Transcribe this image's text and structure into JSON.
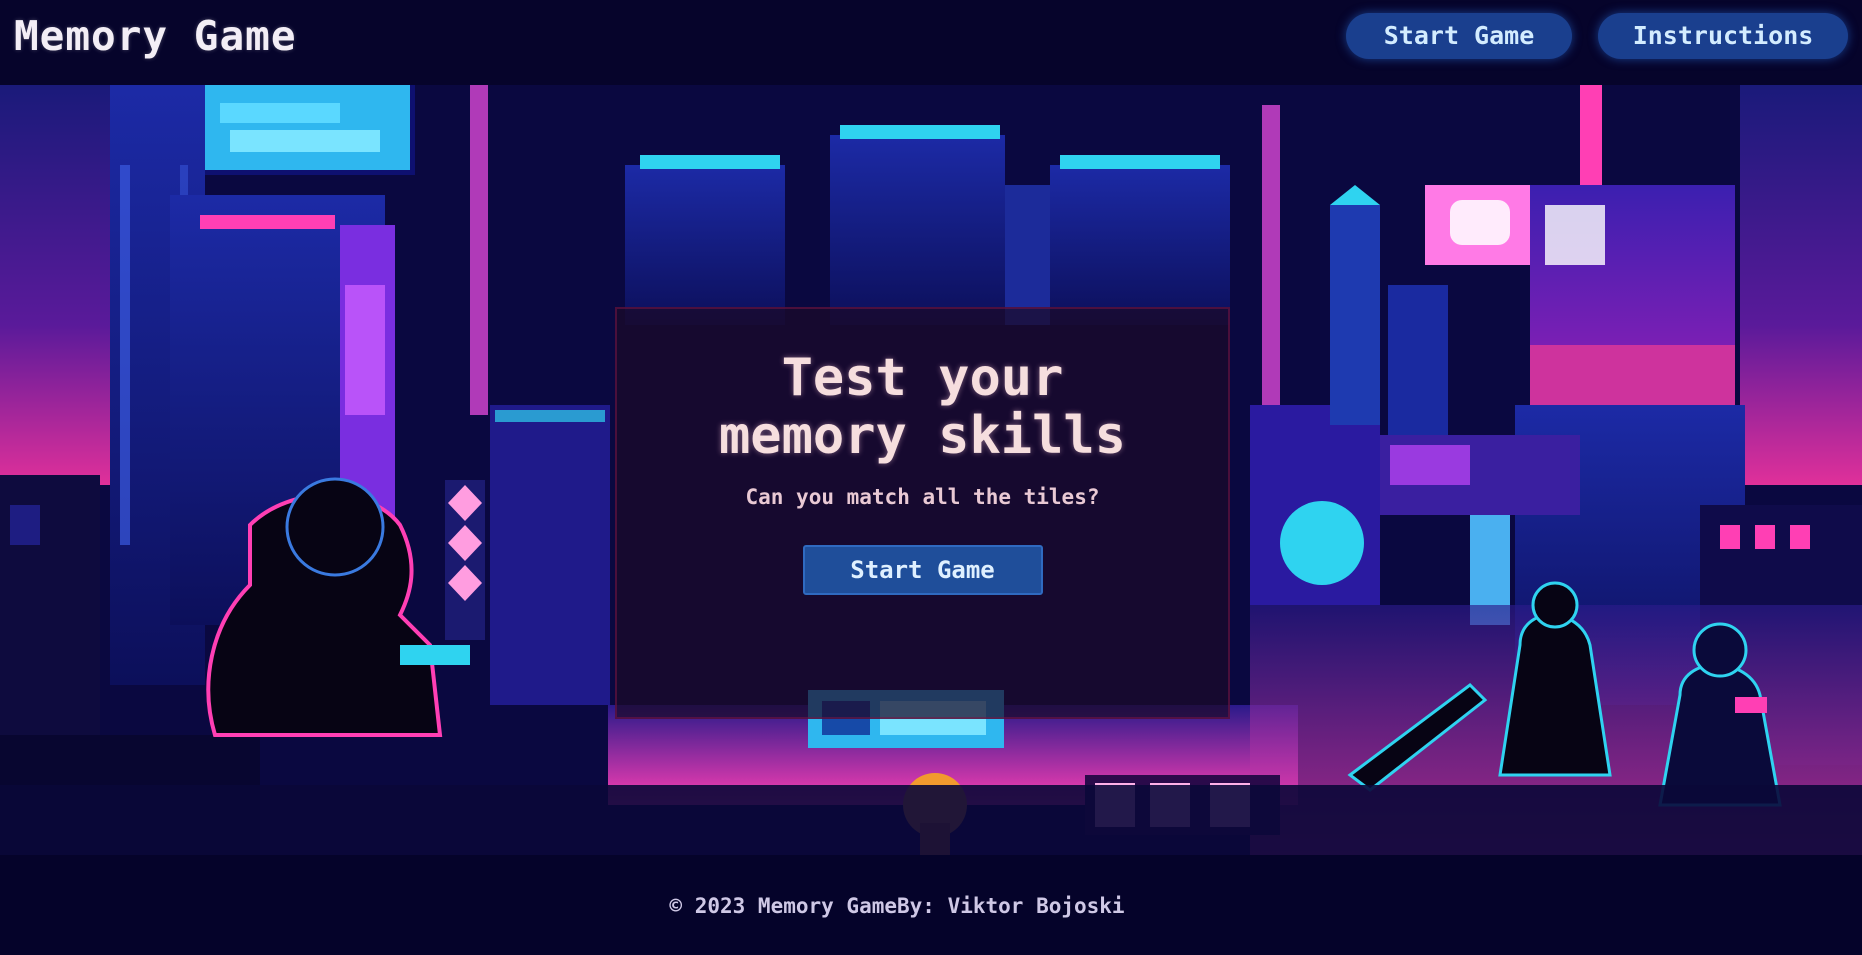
{
  "header": {
    "logo": "Memory Game",
    "nav": {
      "start_label": "Start Game",
      "instructions_label": "Instructions"
    }
  },
  "hero": {
    "title_line1": "Test your",
    "title_line2": "memory skills",
    "subtitle": "Can you match all the tiles?",
    "cta_label": "Start Game",
    "background_art": "pixel-art cyberpunk city at night"
  },
  "footer": {
    "text": "© 2023 Memory GameBy: Viktor Bojoski"
  },
  "colors": {
    "page_bg": "#05032a",
    "button_bg": "#1a3f8e",
    "neon_pink": "#ff3fb4",
    "neon_cyan": "#2fd3f0",
    "card_bg": "#1c0a28"
  }
}
